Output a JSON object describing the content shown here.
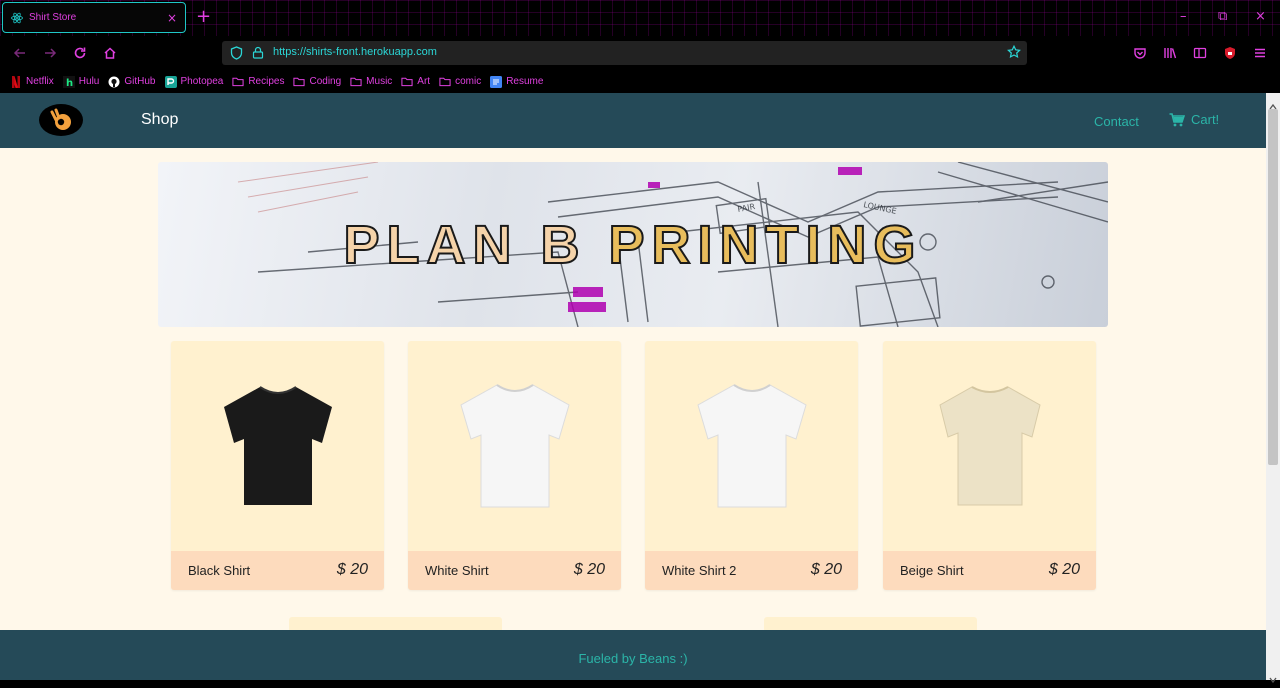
{
  "browser": {
    "tab_title": "Shirt Store",
    "tab_close": "×",
    "new_tab": "+",
    "url": "https://shirts-front.herokuapp.com",
    "window_minimize": "–",
    "window_restore": "⧉",
    "window_close": "×",
    "accent_color": "#e040e0",
    "url_color": "#2bd6d6"
  },
  "bookmarks": [
    {
      "label": "Netflix",
      "icon": "netflix-icon"
    },
    {
      "label": "Hulu",
      "icon": "hulu-icon"
    },
    {
      "label": "GitHub",
      "icon": "github-icon"
    },
    {
      "label": "Photopea",
      "icon": "photopea-icon"
    },
    {
      "label": "Recipes",
      "icon": "folder-icon"
    },
    {
      "label": "Coding",
      "icon": "folder-icon"
    },
    {
      "label": "Music",
      "icon": "folder-icon"
    },
    {
      "label": "Art",
      "icon": "folder-icon"
    },
    {
      "label": "comic",
      "icon": "folder-icon"
    },
    {
      "label": "Resume",
      "icon": "document-icon"
    }
  ],
  "site": {
    "nav": {
      "shop": "Shop",
      "contact": "Contact",
      "cart": "Cart!"
    },
    "banner": {
      "word1": "PLAN B",
      "word2": "PRINTING"
    },
    "products": [
      {
        "name": "Black Shirt",
        "price": "$ 20",
        "color": "#1a1a1a"
      },
      {
        "name": "White Shirt",
        "price": "$ 20",
        "color": "#f6f6f6"
      },
      {
        "name": "White Shirt 2",
        "price": "$ 20",
        "color": "#f6f6f6"
      },
      {
        "name": "Beige Shirt",
        "price": "$ 20",
        "color": "#ece2c6"
      }
    ],
    "footer": "Fueled by Beans :)",
    "colors": {
      "header_bg": "#254a58",
      "accent": "#2bb5a8",
      "page_bg": "#fff8ea",
      "card_bg": "#fff1cf",
      "card_footer_bg": "#fddbbd"
    }
  }
}
